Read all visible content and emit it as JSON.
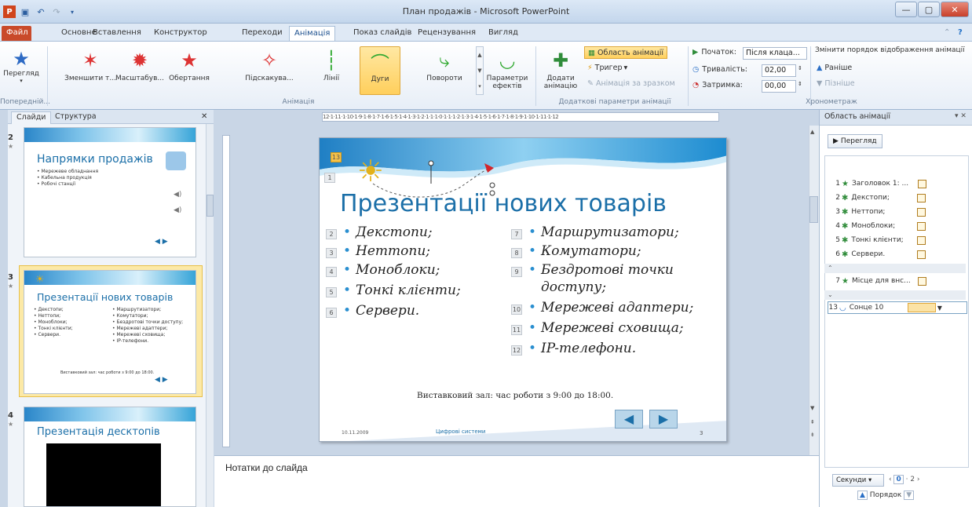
{
  "window": {
    "title": "План продажів - Microsoft PowerPoint"
  },
  "tabs": [
    "Файл",
    "Основне",
    "Вставлення",
    "Конструктор",
    "Переходи",
    "Анімація",
    "Показ слайдів",
    "Рецензування",
    "Вигляд"
  ],
  "ribbon": {
    "preview": "Перегляд",
    "preview_group": "Попередній...",
    "animations_group": "Анімація",
    "gallery": [
      "Зменшити т...",
      "Масштабув...",
      "Обертання",
      "Підскакува...",
      "Лінії",
      "Дуги",
      "Повороти"
    ],
    "effects": "Параметри ефектів",
    "add_animation": "Додати анімацію",
    "animation_pane": "Область анімації",
    "trigger": "Тригер",
    "painter": "Анімація за зразком",
    "advanced_group": "Додаткові параметри анімації",
    "start_label": "Початок:",
    "start_value": "Після клаца...",
    "duration_label": "Тривалість:",
    "duration_value": "02,00",
    "delay_label": "Затримка:",
    "delay_value": "00,00",
    "reorder": "Змінити порядок відображення анімації",
    "earlier": "Раніше",
    "later": "Пізніше",
    "timing_group": "Хронометраж"
  },
  "left_pane": {
    "tab_slides": "Слайди",
    "tab_outline": "Структура",
    "thumbs": [
      {
        "num": "2",
        "title": "Напрямки продажів",
        "lines": [
          "Мережеве обладнання",
          "Кабельна продукція",
          "Робочі станції"
        ]
      },
      {
        "num": "3",
        "title": "Презентації нових товарів",
        "lines_left": [
          "Декстопи;",
          "Неттопи;",
          "Моноблоки;",
          "Тонкі клієнти;",
          "Сервери."
        ],
        "lines_right": [
          "Маршрутизатори;",
          "Комутатори;",
          "Бездротові точки доступу;",
          "Мережеві адаптери;",
          "Мережеві сховища;",
          "IP-телефони."
        ],
        "footer": "Виставковий зал: час роботи з 9:00 до 18:00."
      },
      {
        "num": "4",
        "title": "Презентація десктопів"
      }
    ]
  },
  "ruler": "12·1·11·1·10·1·9·1·8·1·7·1·6·1·5·1·4·1·3·1·2·1·1·1·0·1·1·1·2·1·3·1·4·1·5·1·6·1·7·1·8·1·9·1·10·1·11·1·12",
  "slide": {
    "title": "Презентації нових товарів",
    "left": [
      "Декстопи;",
      "Неттопи;",
      "Моноблоки;",
      "Тонкі клієнти;",
      "Сервери."
    ],
    "left_tags": [
      "2",
      "3",
      "4",
      "5",
      "6"
    ],
    "right": [
      "Маршрутизатори;",
      "Комутатори;",
      "Бездротові точки",
      "доступу;",
      "Мережеві адаптери;",
      "Мережеві сховища;",
      "IP-телефони."
    ],
    "right_tags": [
      "7",
      "8",
      "9",
      "10",
      "11",
      "12"
    ],
    "title_tag": "1",
    "sun_tag": "13",
    "footer": "Виставковий зал: час роботи з 9:00 до 18:00.",
    "date": "10.11.2009",
    "company": "Цифрові системи",
    "page": "3"
  },
  "notes": "Нотатки до слайда",
  "anim_pane": {
    "title": "Область анімації",
    "play": "Перегляд",
    "items": [
      {
        "n": "1",
        "label": "Заголовок 1: ..."
      },
      {
        "n": "2",
        "label": "Декстопи;"
      },
      {
        "n": "3",
        "label": "Неттопи;"
      },
      {
        "n": "4",
        "label": "Моноблоки;"
      },
      {
        "n": "5",
        "label": "Тонкі клієнти;"
      },
      {
        "n": "6",
        "label": "Сервери."
      },
      {
        "n": "7",
        "label": "Місце для внс..."
      },
      {
        "n": "13",
        "label": "Сонце 10"
      }
    ],
    "seconds": "Секунди",
    "zero": "0",
    "two": "2",
    "order": "Порядок"
  }
}
